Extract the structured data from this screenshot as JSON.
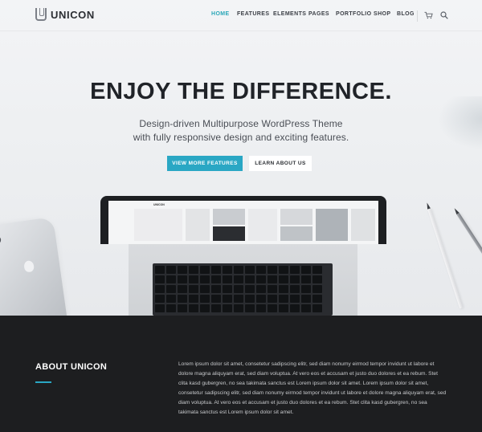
{
  "header": {
    "logo_text": "UNICON",
    "menu": [
      {
        "label": "HOME",
        "active": true
      },
      {
        "label": "FEATURES",
        "active": false
      },
      {
        "label": "ELEMENTS",
        "active": false
      },
      {
        "label": "PAGES",
        "active": false
      },
      {
        "label": "PORTFOLIO",
        "active": false
      },
      {
        "label": "SHOP",
        "active": false
      },
      {
        "label": "BLOG",
        "active": false
      }
    ],
    "icons": [
      "cart-icon",
      "search-icon"
    ]
  },
  "hero": {
    "headline": "ENJOY THE DIFFERENCE.",
    "subline_1": "Design-driven Multipurpose WordPress Theme",
    "subline_2": "with fully responsive design and exciting features.",
    "primary_button": "VIEW MORE FEATURES",
    "secondary_button": "LEARN ABOUT US",
    "laptop_screen_logo": "UNICON"
  },
  "about": {
    "title": "ABOUT UNICON",
    "body": "Lorem ipsum dolor sit amet, consetetur sadipscing elitr, sed diam nonumy eirmod tempor invidunt ut labore et dolore magna aliquyam erat, sed diam voluptua. At vero eos et accusam et justo duo dolores et ea rebum. Stet clita kasd gubergren, no sea takimata sanctus est Lorem ipsum dolor sit amet. Lorem ipsum dolor sit amet, consetetur sadipscing elitr, sed diam nonumy eirmod tempor invidunt ut labore et dolore magna aliquyam erat, sed diam voluptua. At vero eos et accusam et justo duo dolores et ea rebum. Stet clita kasd gubergren, no sea takimata sanctus est Lorem ipsum dolor sit amet."
  },
  "colors": {
    "accent": "#2aa7c4",
    "dark_section": "#1d1e20",
    "headline": "#202328"
  }
}
